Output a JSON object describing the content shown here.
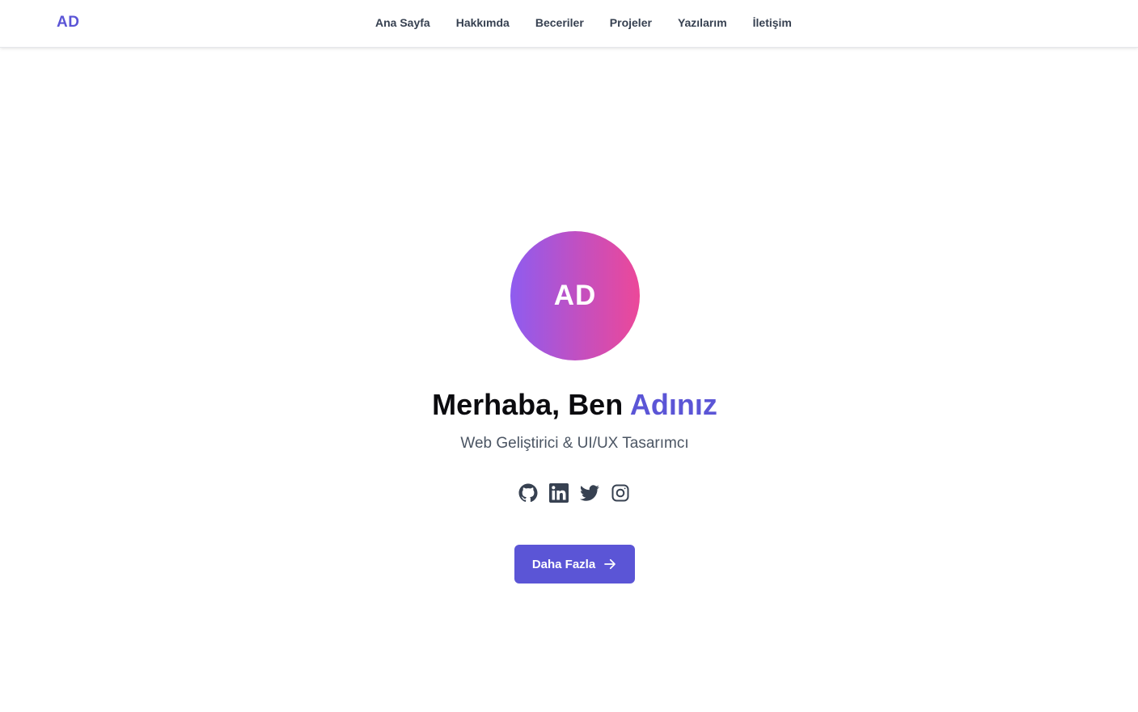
{
  "nav": {
    "logo": "AD",
    "links": [
      "Ana Sayfa",
      "Hakkımda",
      "Beceriler",
      "Projeler",
      "Yazılarım",
      "İletişim"
    ]
  },
  "hero": {
    "avatar_initials": "AD",
    "headline_prefix": "Merhaba, Ben ",
    "headline_name": "Adınız",
    "subtitle": "Web Geliştirici & UI/UX Tasarımcı",
    "socials": [
      {
        "icon": "github-icon"
      },
      {
        "icon": "linkedin-icon"
      },
      {
        "icon": "twitter-icon"
      },
      {
        "icon": "instagram-icon"
      }
    ],
    "cta_label": "Daha Fazla",
    "cta_icon": "arrow-right-icon"
  },
  "colors": {
    "accent": "#5b55d6",
    "gradient_start": "#8e5cf0",
    "gradient_end": "#ec4899",
    "text_dark": "#0b0b0f",
    "text_muted": "#4b5563"
  }
}
